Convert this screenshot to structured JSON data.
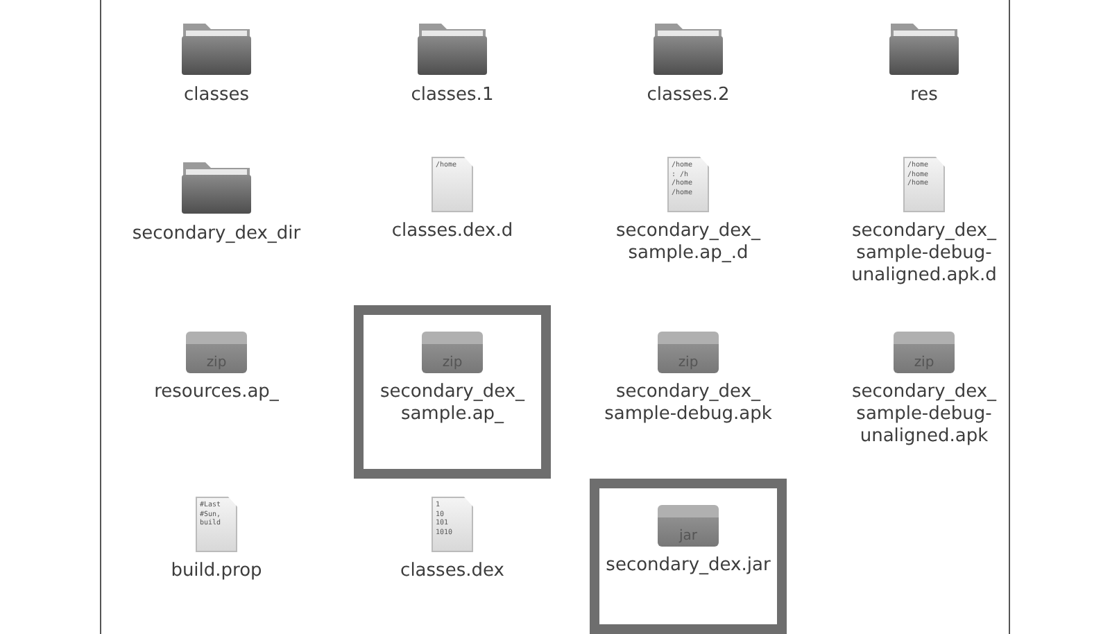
{
  "files": [
    {
      "kind": "folder",
      "name": [
        "classes"
      ],
      "highlighted": false
    },
    {
      "kind": "folder",
      "name": [
        "classes.1"
      ],
      "highlighted": false
    },
    {
      "kind": "folder",
      "name": [
        "classes.2"
      ],
      "highlighted": false
    },
    {
      "kind": "folder",
      "name": [
        "res"
      ],
      "highlighted": false
    },
    {
      "kind": "folder",
      "name": [
        "secondary_dex_dir"
      ],
      "highlighted": false
    },
    {
      "kind": "text",
      "preview": [
        "/home"
      ],
      "name": [
        "classes.dex.d"
      ],
      "highlighted": false
    },
    {
      "kind": "text",
      "preview": [
        "/home",
        ": /h",
        "/home",
        "/home"
      ],
      "name": [
        "secondary_dex_",
        "sample.ap_.d"
      ],
      "highlighted": false
    },
    {
      "kind": "text",
      "preview": [
        "/home",
        "/home",
        "/home"
      ],
      "name": [
        "secondary_dex_",
        "sample-debug-",
        "unaligned.apk.d"
      ],
      "highlighted": false
    },
    {
      "kind": "archive",
      "badge": "zip",
      "name": [
        "resources.ap_"
      ],
      "highlighted": false
    },
    {
      "kind": "archive",
      "badge": "zip",
      "name": [
        "secondary_dex_",
        "sample.ap_"
      ],
      "highlighted": true
    },
    {
      "kind": "archive",
      "badge": "zip",
      "name": [
        "secondary_dex_",
        "sample-debug.apk"
      ],
      "highlighted": false
    },
    {
      "kind": "archive",
      "badge": "zip",
      "name": [
        "secondary_dex_",
        "sample-debug-",
        "unaligned.apk"
      ],
      "highlighted": false
    },
    {
      "kind": "text",
      "preview": [
        "#Last",
        "#Sun,",
        "build"
      ],
      "name": [
        "build.prop"
      ],
      "highlighted": false
    },
    {
      "kind": "text",
      "preview": [
        "1",
        "10",
        "101",
        "1010"
      ],
      "name": [
        "classes.dex"
      ],
      "highlighted": false
    },
    {
      "kind": "archive",
      "badge": "jar",
      "name": [
        "secondary_dex.jar"
      ],
      "highlighted": true
    }
  ]
}
